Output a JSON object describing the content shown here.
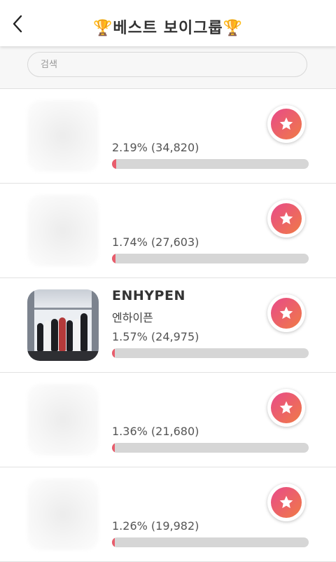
{
  "header": {
    "title": "🏆베스트 보이그룹🏆"
  },
  "search": {
    "placeholder": "검색",
    "value": ""
  },
  "colors": {
    "bar_fill": "#e85d6c",
    "bar_track": "#d6d6d6",
    "vote_gradient_start": "#e84a8a",
    "vote_gradient_end": "#f07b45"
  },
  "rankings": [
    {
      "name": "",
      "sub": "",
      "stat": "2.19% (34,820)",
      "percent": 2.19
    },
    {
      "name": "",
      "sub": "",
      "stat": "1.74% (27,603)",
      "percent": 1.74
    },
    {
      "name": "ENHYPEN",
      "sub": "엔하이픈",
      "stat": "1.57% (24,975)",
      "percent": 1.57
    },
    {
      "name": "",
      "sub": "",
      "stat": "1.36% (21,680)",
      "percent": 1.36
    },
    {
      "name": "",
      "sub": "",
      "stat": "1.26% (19,982)",
      "percent": 1.26
    }
  ],
  "icons": {
    "back": "chevron-left-icon",
    "vote": "star-icon"
  }
}
